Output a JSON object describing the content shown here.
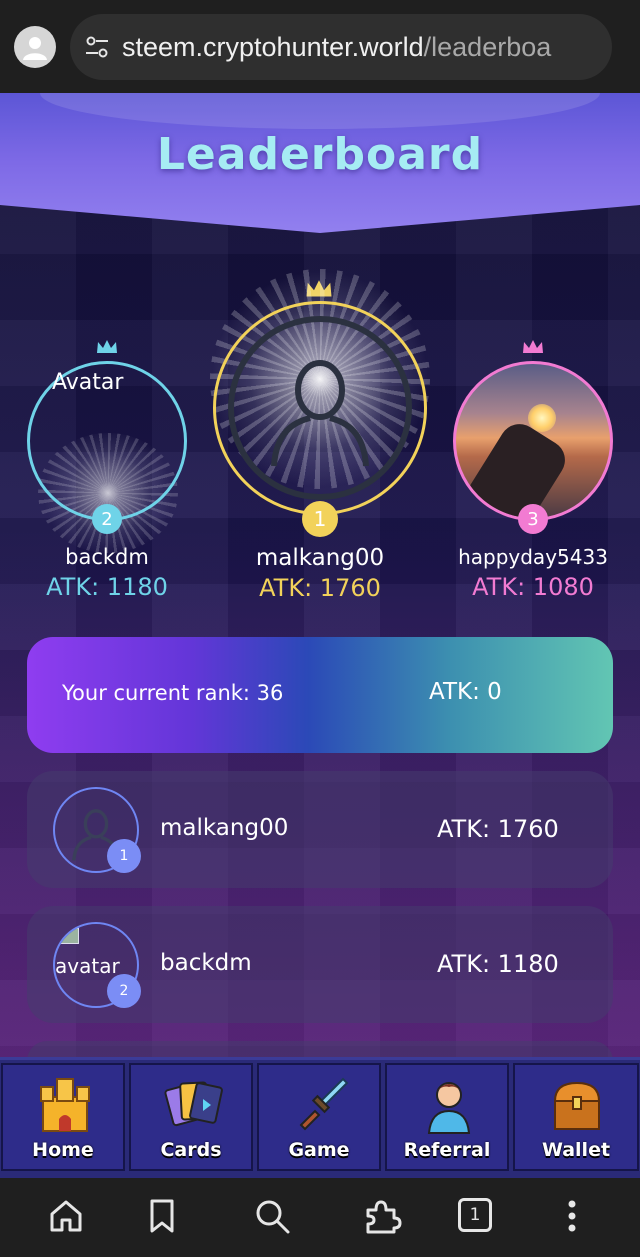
{
  "browser": {
    "url_domain": "steem.cryptohunter.world",
    "url_path": "/leaderboa",
    "tabs_count": "1"
  },
  "page": {
    "title": "Leaderboard"
  },
  "podium": {
    "first": {
      "rank": "1",
      "name": "malkang00",
      "atk": "ATK: 1760",
      "color": "#f2d25a"
    },
    "second": {
      "rank": "2",
      "name": "backdm",
      "atk": "ATK: 1180",
      "avatar_alt": "Avatar",
      "color": "#6fd3e8"
    },
    "third": {
      "rank": "3",
      "name": "happyday5433",
      "atk": "ATK: 1080",
      "color": "#f27bd2"
    }
  },
  "current_rank": {
    "label": "Your current rank: 36",
    "atk": "ATK: 0"
  },
  "list": [
    {
      "rank": "1",
      "name": "malkang00",
      "atk": "ATK: 1760"
    },
    {
      "rank": "2",
      "name": "backdm",
      "atk": "ATK: 1180",
      "avatar_alt": "avatar"
    }
  ],
  "nav": {
    "items": [
      {
        "label": "Home",
        "icon": "castle-icon"
      },
      {
        "label": "Cards",
        "icon": "cards-icon"
      },
      {
        "label": "Game",
        "icon": "sword-icon"
      },
      {
        "label": "Referral",
        "icon": "person-icon"
      },
      {
        "label": "Wallet",
        "icon": "treasure-chest-icon"
      }
    ]
  }
}
